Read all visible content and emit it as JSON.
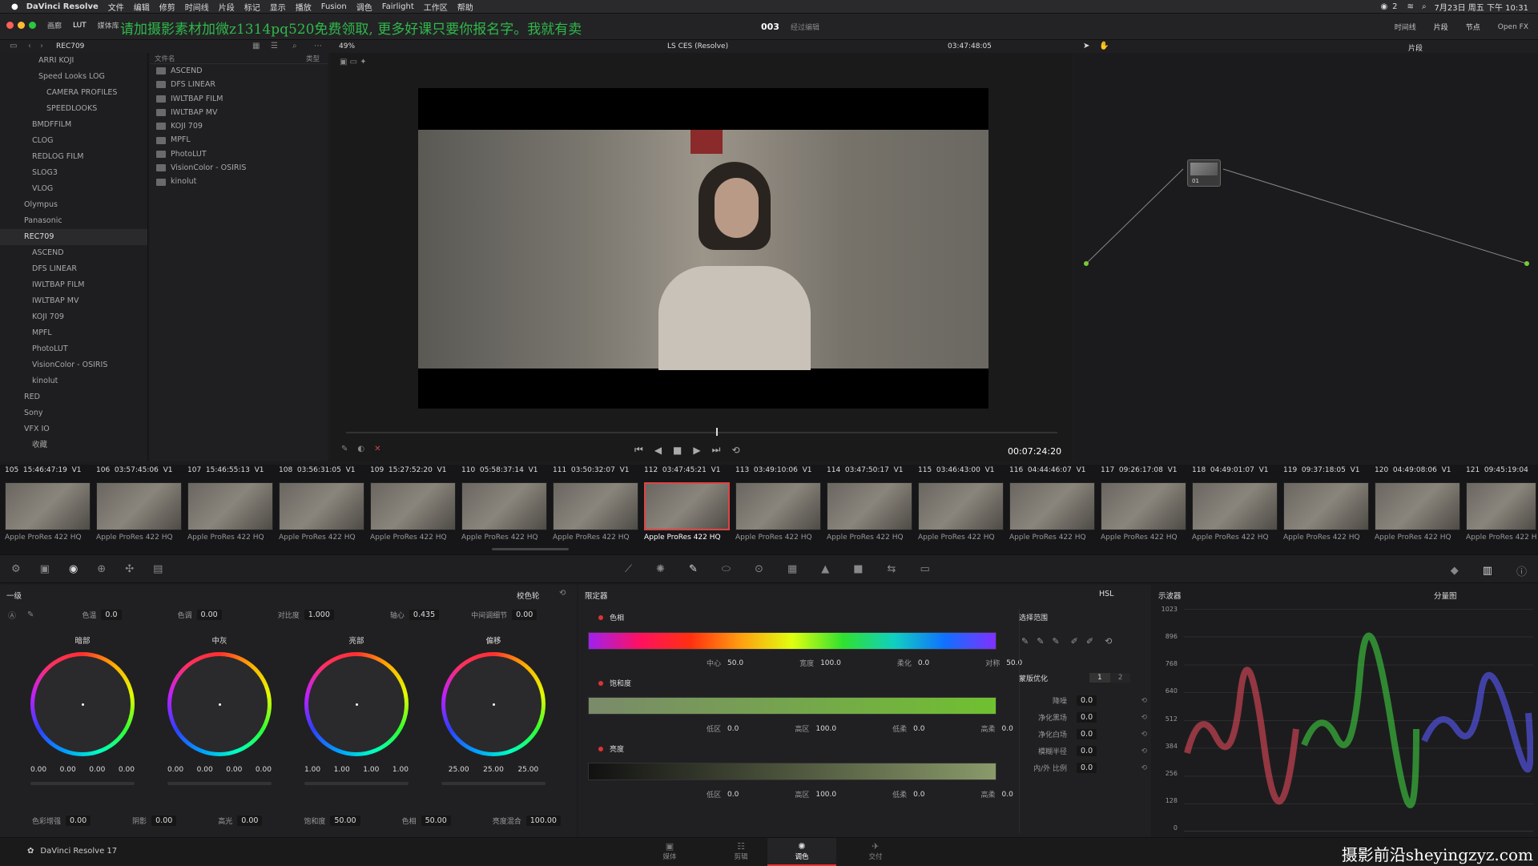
{
  "menubar": {
    "app": "DaVinci Resolve",
    "items": [
      "文件",
      "编辑",
      "修剪",
      "时间线",
      "片段",
      "标记",
      "显示",
      "播放",
      "Fusion",
      "调色",
      "Fairlight",
      "工作区",
      "帮助"
    ],
    "status_icons_count": "2",
    "clock": "7月23日 周五 下午 10:31"
  },
  "titlebar": {
    "left_buttons": [
      "画廊",
      "LUT",
      "媒体库"
    ],
    "watermark_banner": "请加摄影素材加微z1314pq520免费领取, 更多好课只要你报名字。我就有卖",
    "project_num": "003",
    "project_sub": "经过编辑",
    "right_buttons": [
      "时间线",
      "片段",
      "节点",
      "Open FX"
    ]
  },
  "subbar": {
    "breadcrumb": "REC709",
    "zoom": "49%",
    "color_space": "LS CES (Resolve)",
    "timecode": "03:47:48:05",
    "node_mode": "片段"
  },
  "lut_tree": [
    "ARRI KOJI",
    "Speed Looks LOG",
    "CAMERA PROFILES",
    "SPEEDLOOKS",
    "BMDFFILM",
    "CLOG",
    "REDLOG FILM",
    "SLOG3",
    "VLOG",
    "Olympus",
    "Panasonic",
    "REC709",
    "ASCEND",
    "DFS LINEAR",
    "IWLTBAP FILM",
    "IWLTBAP MV",
    "KOJI 709",
    "MPFL",
    "PhotoLUT",
    "VisionColor - OSIRIS",
    "kinolut",
    "RED",
    "Sony",
    "VFX IO",
    "收藏"
  ],
  "file_list": {
    "col_name": "文件名",
    "col_type": "类型",
    "items": [
      "ASCEND",
      "DFS LINEAR",
      "IWLTBAP FILM",
      "IWLTBAP MV",
      "KOJI 709",
      "MPFL",
      "PhotoLUT",
      "VisionColor - OSIRIS",
      "kinolut"
    ]
  },
  "viewer": {
    "timecode": "00:07:24:20"
  },
  "node": {
    "label": "01"
  },
  "clips": [
    {
      "num": "105",
      "tc": "15:46:47:19",
      "track": "V1",
      "codec": "Apple ProRes 422 HQ"
    },
    {
      "num": "106",
      "tc": "03:57:45:06",
      "track": "V1",
      "codec": "Apple ProRes 422 HQ"
    },
    {
      "num": "107",
      "tc": "15:46:55:13",
      "track": "V1",
      "codec": "Apple ProRes 422 HQ"
    },
    {
      "num": "108",
      "tc": "03:56:31:05",
      "track": "V1",
      "codec": "Apple ProRes 422 HQ"
    },
    {
      "num": "109",
      "tc": "15:27:52:20",
      "track": "V1",
      "codec": "Apple ProRes 422 HQ"
    },
    {
      "num": "110",
      "tc": "05:58:37:14",
      "track": "V1",
      "codec": "Apple ProRes 422 HQ"
    },
    {
      "num": "111",
      "tc": "03:50:32:07",
      "track": "V1",
      "codec": "Apple ProRes 422 HQ"
    },
    {
      "num": "112",
      "tc": "03:47:45:21",
      "track": "V1",
      "codec": "Apple ProRes 422 HQ"
    },
    {
      "num": "113",
      "tc": "03:49:10:06",
      "track": "V1",
      "codec": "Apple ProRes 422 HQ"
    },
    {
      "num": "114",
      "tc": "03:47:50:17",
      "track": "V1",
      "codec": "Apple ProRes 422 HQ"
    },
    {
      "num": "115",
      "tc": "03:46:43:00",
      "track": "V1",
      "codec": "Apple ProRes 422 HQ"
    },
    {
      "num": "116",
      "tc": "04:44:46:07",
      "track": "V1",
      "codec": "Apple ProRes 422 HQ"
    },
    {
      "num": "117",
      "tc": "09:26:17:08",
      "track": "V1",
      "codec": "Apple ProRes 422 HQ"
    },
    {
      "num": "118",
      "tc": "04:49:01:07",
      "track": "V1",
      "codec": "Apple ProRes 422 HQ"
    },
    {
      "num": "119",
      "tc": "09:37:18:05",
      "track": "V1",
      "codec": "Apple ProRes 422 HQ"
    },
    {
      "num": "120",
      "tc": "04:49:08:06",
      "track": "V1",
      "codec": "Apple ProRes 422 HQ"
    },
    {
      "num": "121",
      "tc": "09:45:19:04",
      "track": "V1",
      "codec": "Apple ProRes 422 HQ"
    }
  ],
  "wheels_panel": {
    "title": "一级",
    "mode": "校色轮",
    "top_params": [
      {
        "label": "色温",
        "value": "0.0"
      },
      {
        "label": "色调",
        "value": "0.00"
      },
      {
        "label": "对比度",
        "value": "1.000"
      },
      {
        "label": "轴心",
        "value": "0.435"
      },
      {
        "label": "中间调细节",
        "value": "0.00"
      }
    ],
    "wheels": [
      {
        "name": "暗部",
        "values": [
          "0.00",
          "0.00",
          "0.00",
          "0.00"
        ]
      },
      {
        "name": "中灰",
        "values": [
          "0.00",
          "0.00",
          "0.00",
          "0.00"
        ]
      },
      {
        "name": "亮部",
        "values": [
          "1.00",
          "1.00",
          "1.00",
          "1.00"
        ]
      },
      {
        "name": "偏移",
        "values": [
          "25.00",
          "25.00",
          "25.00"
        ]
      }
    ],
    "bottom_params": [
      {
        "label": "色彩增强",
        "value": "0.00"
      },
      {
        "label": "阴影",
        "value": "0.00"
      },
      {
        "label": "高光",
        "value": "0.00"
      },
      {
        "label": "饱和度",
        "value": "50.00"
      },
      {
        "label": "色相",
        "value": "50.00"
      },
      {
        "label": "亮度混合",
        "value": "100.00"
      }
    ]
  },
  "qualifier": {
    "title": "限定器",
    "mode": "HSL",
    "hue": {
      "label": "色相",
      "params": [
        {
          "label": "中心",
          "value": "50.0"
        },
        {
          "label": "宽度",
          "value": "100.0"
        },
        {
          "label": "柔化",
          "value": "0.0"
        },
        {
          "label": "对称",
          "value": "50.0"
        }
      ]
    },
    "sat": {
      "label": "饱和度",
      "params": [
        {
          "label": "低区",
          "value": "0.0"
        },
        {
          "label": "高区",
          "value": "100.0"
        },
        {
          "label": "低柔",
          "value": "0.0"
        },
        {
          "label": "高柔",
          "value": "0.0"
        }
      ]
    },
    "lum": {
      "label": "亮度",
      "params": [
        {
          "label": "低区",
          "value": "0.0"
        },
        {
          "label": "高区",
          "value": "100.0"
        },
        {
          "label": "低柔",
          "value": "0.0"
        },
        {
          "label": "高柔",
          "value": "0.0"
        }
      ]
    },
    "selection_title": "选择范围",
    "matte_title": "蒙版优化",
    "matte_tabs": [
      "1",
      "2"
    ],
    "matte_params": [
      {
        "label": "降噪",
        "value": "0.0"
      },
      {
        "label": "净化黑场",
        "value": "0.0"
      },
      {
        "label": "净化白场",
        "value": "0.0"
      },
      {
        "label": "模糊半径",
        "value": "0.0"
      },
      {
        "label": "内/外 比例",
        "value": "0.0"
      }
    ]
  },
  "scope": {
    "title": "示波器",
    "mode": "分量图",
    "ticks": [
      "1023",
      "896",
      "768",
      "640",
      "512",
      "384",
      "256",
      "128",
      "0"
    ]
  },
  "pagebar": {
    "app_label": "DaVinci Resolve 17",
    "pages": [
      "媒体",
      "剪辑",
      "调色",
      "交付"
    ],
    "active": "调色",
    "watermark": "摄影前沿sheyingzyz.com"
  }
}
